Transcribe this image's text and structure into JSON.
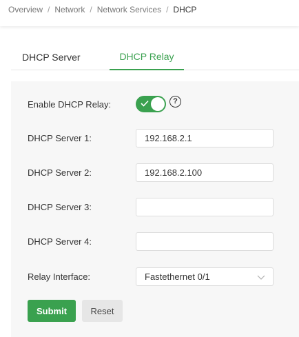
{
  "breadcrumb": {
    "items": [
      "Overview",
      "Network",
      "Network Services",
      "DHCP"
    ],
    "separator": "/"
  },
  "tabs": [
    {
      "label": "DHCP Server",
      "active": false
    },
    {
      "label": "DHCP Relay",
      "active": true
    }
  ],
  "form": {
    "enable_relay": {
      "label": "Enable DHCP Relay:",
      "enabled": true,
      "help": "?"
    },
    "server1": {
      "label": "DHCP Server 1:",
      "value": "192.168.2.1"
    },
    "server2": {
      "label": "DHCP Server 2:",
      "value": "192.168.2.100"
    },
    "server3": {
      "label": "DHCP Server 3:",
      "value": ""
    },
    "server4": {
      "label": "DHCP Server 4:",
      "value": ""
    },
    "relay_interface": {
      "label": "Relay Interface:",
      "value": "Fastethernet 0/1",
      "icon": "chevron-down-icon"
    }
  },
  "buttons": {
    "submit": "Submit",
    "reset": "Reset"
  },
  "colors": {
    "accent": "#3aa14f",
    "panel_bg": "#f7f7f7",
    "reset_bg": "#e6e6e6"
  }
}
